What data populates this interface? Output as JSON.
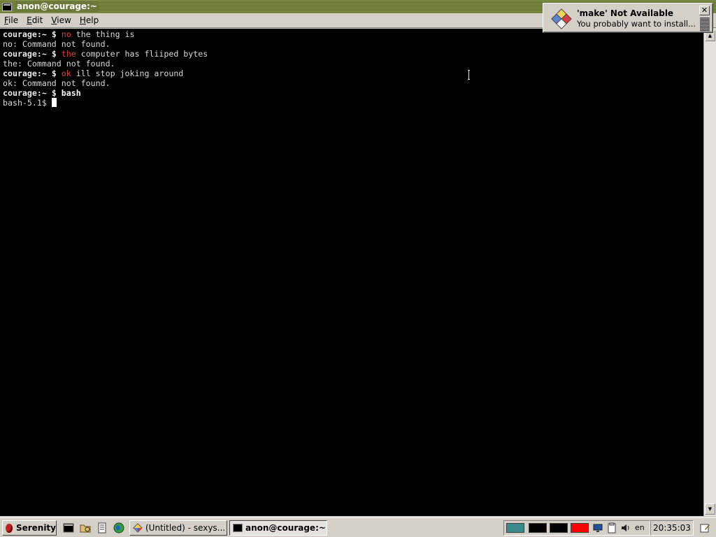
{
  "window": {
    "title": "anon@courage:~"
  },
  "menu": {
    "items": [
      {
        "mnemonic": "F",
        "rest": "ile"
      },
      {
        "mnemonic": "E",
        "rest": "dit"
      },
      {
        "mnemonic": "V",
        "rest": "iew"
      },
      {
        "mnemonic": "H",
        "rest": "elp"
      }
    ]
  },
  "terminal": {
    "lines": [
      {
        "prompt": "courage",
        "sep": ":~ $ ",
        "cmd": "no",
        "cmd_style": "err",
        "args": " the thing is"
      },
      {
        "text": "no: Command not found."
      },
      {
        "prompt": "courage",
        "sep": ":~ $ ",
        "cmd": "the",
        "cmd_style": "err",
        "args": " computer has fliiped bytes"
      },
      {
        "text": "the: Command not found."
      },
      {
        "prompt": "courage",
        "sep": ":~ $ ",
        "cmd": "ok",
        "cmd_style": "err",
        "args": " ill stop joking around"
      },
      {
        "text": "ok: Command not found."
      },
      {
        "prompt": "courage",
        "sep": ":~ $ ",
        "cmd": "bash",
        "cmd_style": "ok",
        "args": ""
      },
      {
        "text": "bash-5.1$ ",
        "cursor": true
      }
    ]
  },
  "notification": {
    "title": "'make' Not Available",
    "body": "You probably want to install...",
    "close_label": "✕",
    "icon": "package-diamond-icon"
  },
  "taskbar": {
    "start_label": "Serenity",
    "tasks": [
      {
        "label": "(Untitled) - sexys...",
        "icon": "diamond-icon"
      },
      {
        "label": "anon@courage:~",
        "icon": "terminal-icon"
      }
    ],
    "quick_launch": [
      "terminal-icon",
      "file-manager-icon",
      "text-editor-icon",
      "browser-icon"
    ],
    "tray_language": "en",
    "clock": "20:35:03",
    "colors": {
      "desktop_1": "#3a8a8a",
      "desktop_4": "#ff0000"
    }
  }
}
